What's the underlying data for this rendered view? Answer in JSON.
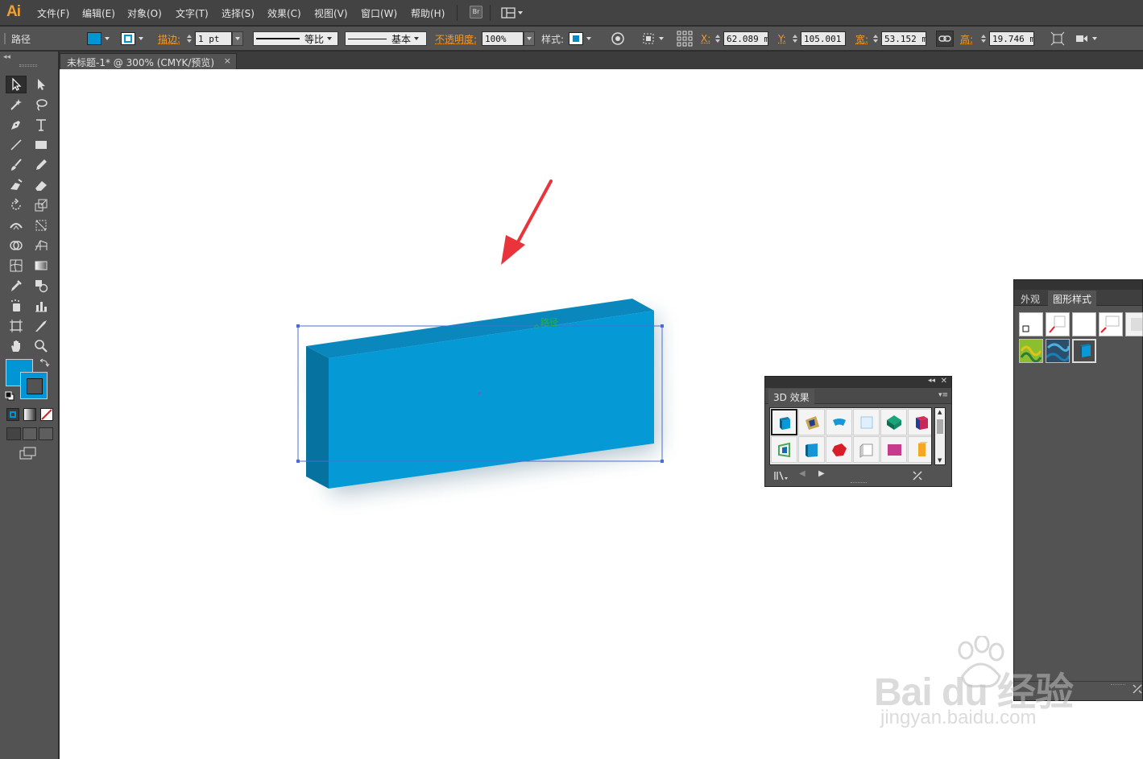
{
  "app": {
    "logo": "Ai"
  },
  "menu": {
    "items": [
      "文件(F)",
      "编辑(E)",
      "对象(O)",
      "文字(T)",
      "选择(S)",
      "效果(C)",
      "视图(V)",
      "窗口(W)",
      "帮助(H)"
    ],
    "bridge_label": "Br"
  },
  "control_bar": {
    "selection_type": "路径",
    "fill_color": "#0096d6",
    "stroke_label": "描边:",
    "stroke_weight": "1 pt",
    "stroke_profile": "等比",
    "brush": "基本",
    "opacity_label": "不透明度:",
    "opacity_value": "100%",
    "style_label": "样式:",
    "x_label": "X:",
    "x_value": "62.089 m",
    "y_label": "Y:",
    "y_value": "105.001 m",
    "w_label": "宽:",
    "w_value": "53.152 m",
    "h_label": "高:",
    "h_value": "19.746 m"
  },
  "document": {
    "tab_title": "未标题-1* @ 300% (CMYK/预览)",
    "close_glyph": "×"
  },
  "canvas": {
    "hover_label": "路径",
    "shape_colors": {
      "front": "#0599d6",
      "top": "#0a88bd",
      "side": "#06729f",
      "annotation_arrow": "#e8343a"
    }
  },
  "panel_3d": {
    "title": "3D 效果",
    "styles": [
      "blue-cube-style",
      "tan-panel-style",
      "blue-arc-style",
      "glass-square-style",
      "green-box-style",
      "blue-red-box-style",
      "green-frame-style",
      "blue-slab-style",
      "red-polyhedron-style",
      "white-cube-style",
      "pink-plane-style",
      "orange-box-style"
    ],
    "selected_index": 0
  },
  "side_panel": {
    "tabs": [
      "外观",
      "图形样式"
    ],
    "active_tab": "图形样式",
    "graphic_styles": [
      "default-style",
      "none-style",
      "white-style",
      "partial-style",
      "shadow-style",
      "green-pattern-style",
      "blue-pattern-style",
      "3d-box-style"
    ],
    "selected_index": 7
  },
  "watermark": {
    "main": "Bai du 经验",
    "sub": "jingyan.baidu.com"
  }
}
